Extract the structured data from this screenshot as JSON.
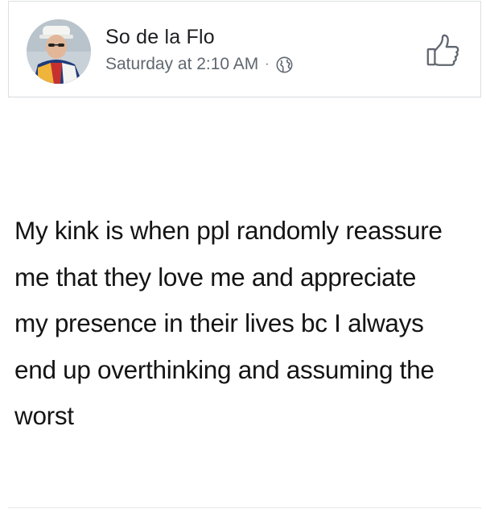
{
  "post": {
    "author_name": "So de la Flo",
    "timestamp": "Saturday at 2:10 AM",
    "separator": "·",
    "audience_icon": "globe-icon",
    "like_icon": "thumbs-up-icon",
    "body_lines": [
      "My kink is when ppl randomly reassure",
      "me that they love me and appreciate",
      "my presence in their lives bc I always",
      "end up overthinking and assuming the",
      "worst"
    ]
  },
  "colors": {
    "name_text": "#1c1e21",
    "meta_text": "#606770",
    "body_text": "#141414",
    "border": "#dddfe2"
  }
}
